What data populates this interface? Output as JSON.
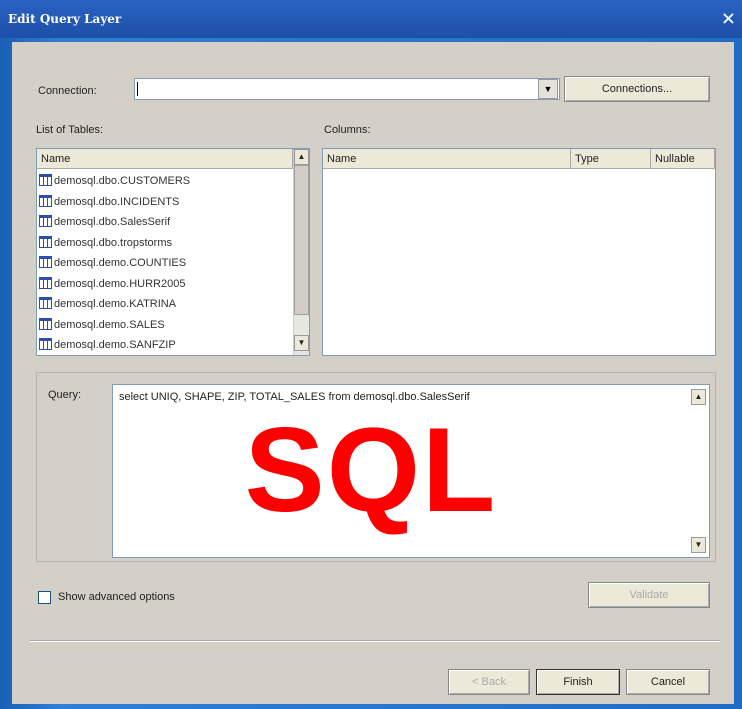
{
  "window": {
    "title": "Edit Query Layer",
    "close_glyph": "×"
  },
  "connection": {
    "label": "Connection:",
    "value": "",
    "button": "Connections..."
  },
  "tables": {
    "label": "List of Tables:",
    "header": "Name",
    "items": [
      "demosql.dbo.CUSTOMERS",
      "demosql.dbo.INCIDENTS",
      "demosql.dbo.SalesSerif",
      "demosql.dbo.tropstorms",
      "demosql.demo.COUNTIES",
      "demosql.demo.HURR2005",
      "demosql.demo.KATRINA",
      "demosql.demo.SALES",
      "demosql.demo.SANFZIP"
    ]
  },
  "columns": {
    "label": "Columns:",
    "headers": [
      "Name",
      "Type",
      "Nullable"
    ]
  },
  "query": {
    "label": "Query:",
    "text": "select UNIQ, SHAPE, ZIP, TOTAL_SALES from demosql.dbo.SalesSerif",
    "overlay": "SQL"
  },
  "advanced": {
    "label": "Show advanced options",
    "checked": false,
    "validate_button": "Validate"
  },
  "footer": {
    "back": "< Back",
    "finish": "Finish",
    "cancel": "Cancel"
  }
}
